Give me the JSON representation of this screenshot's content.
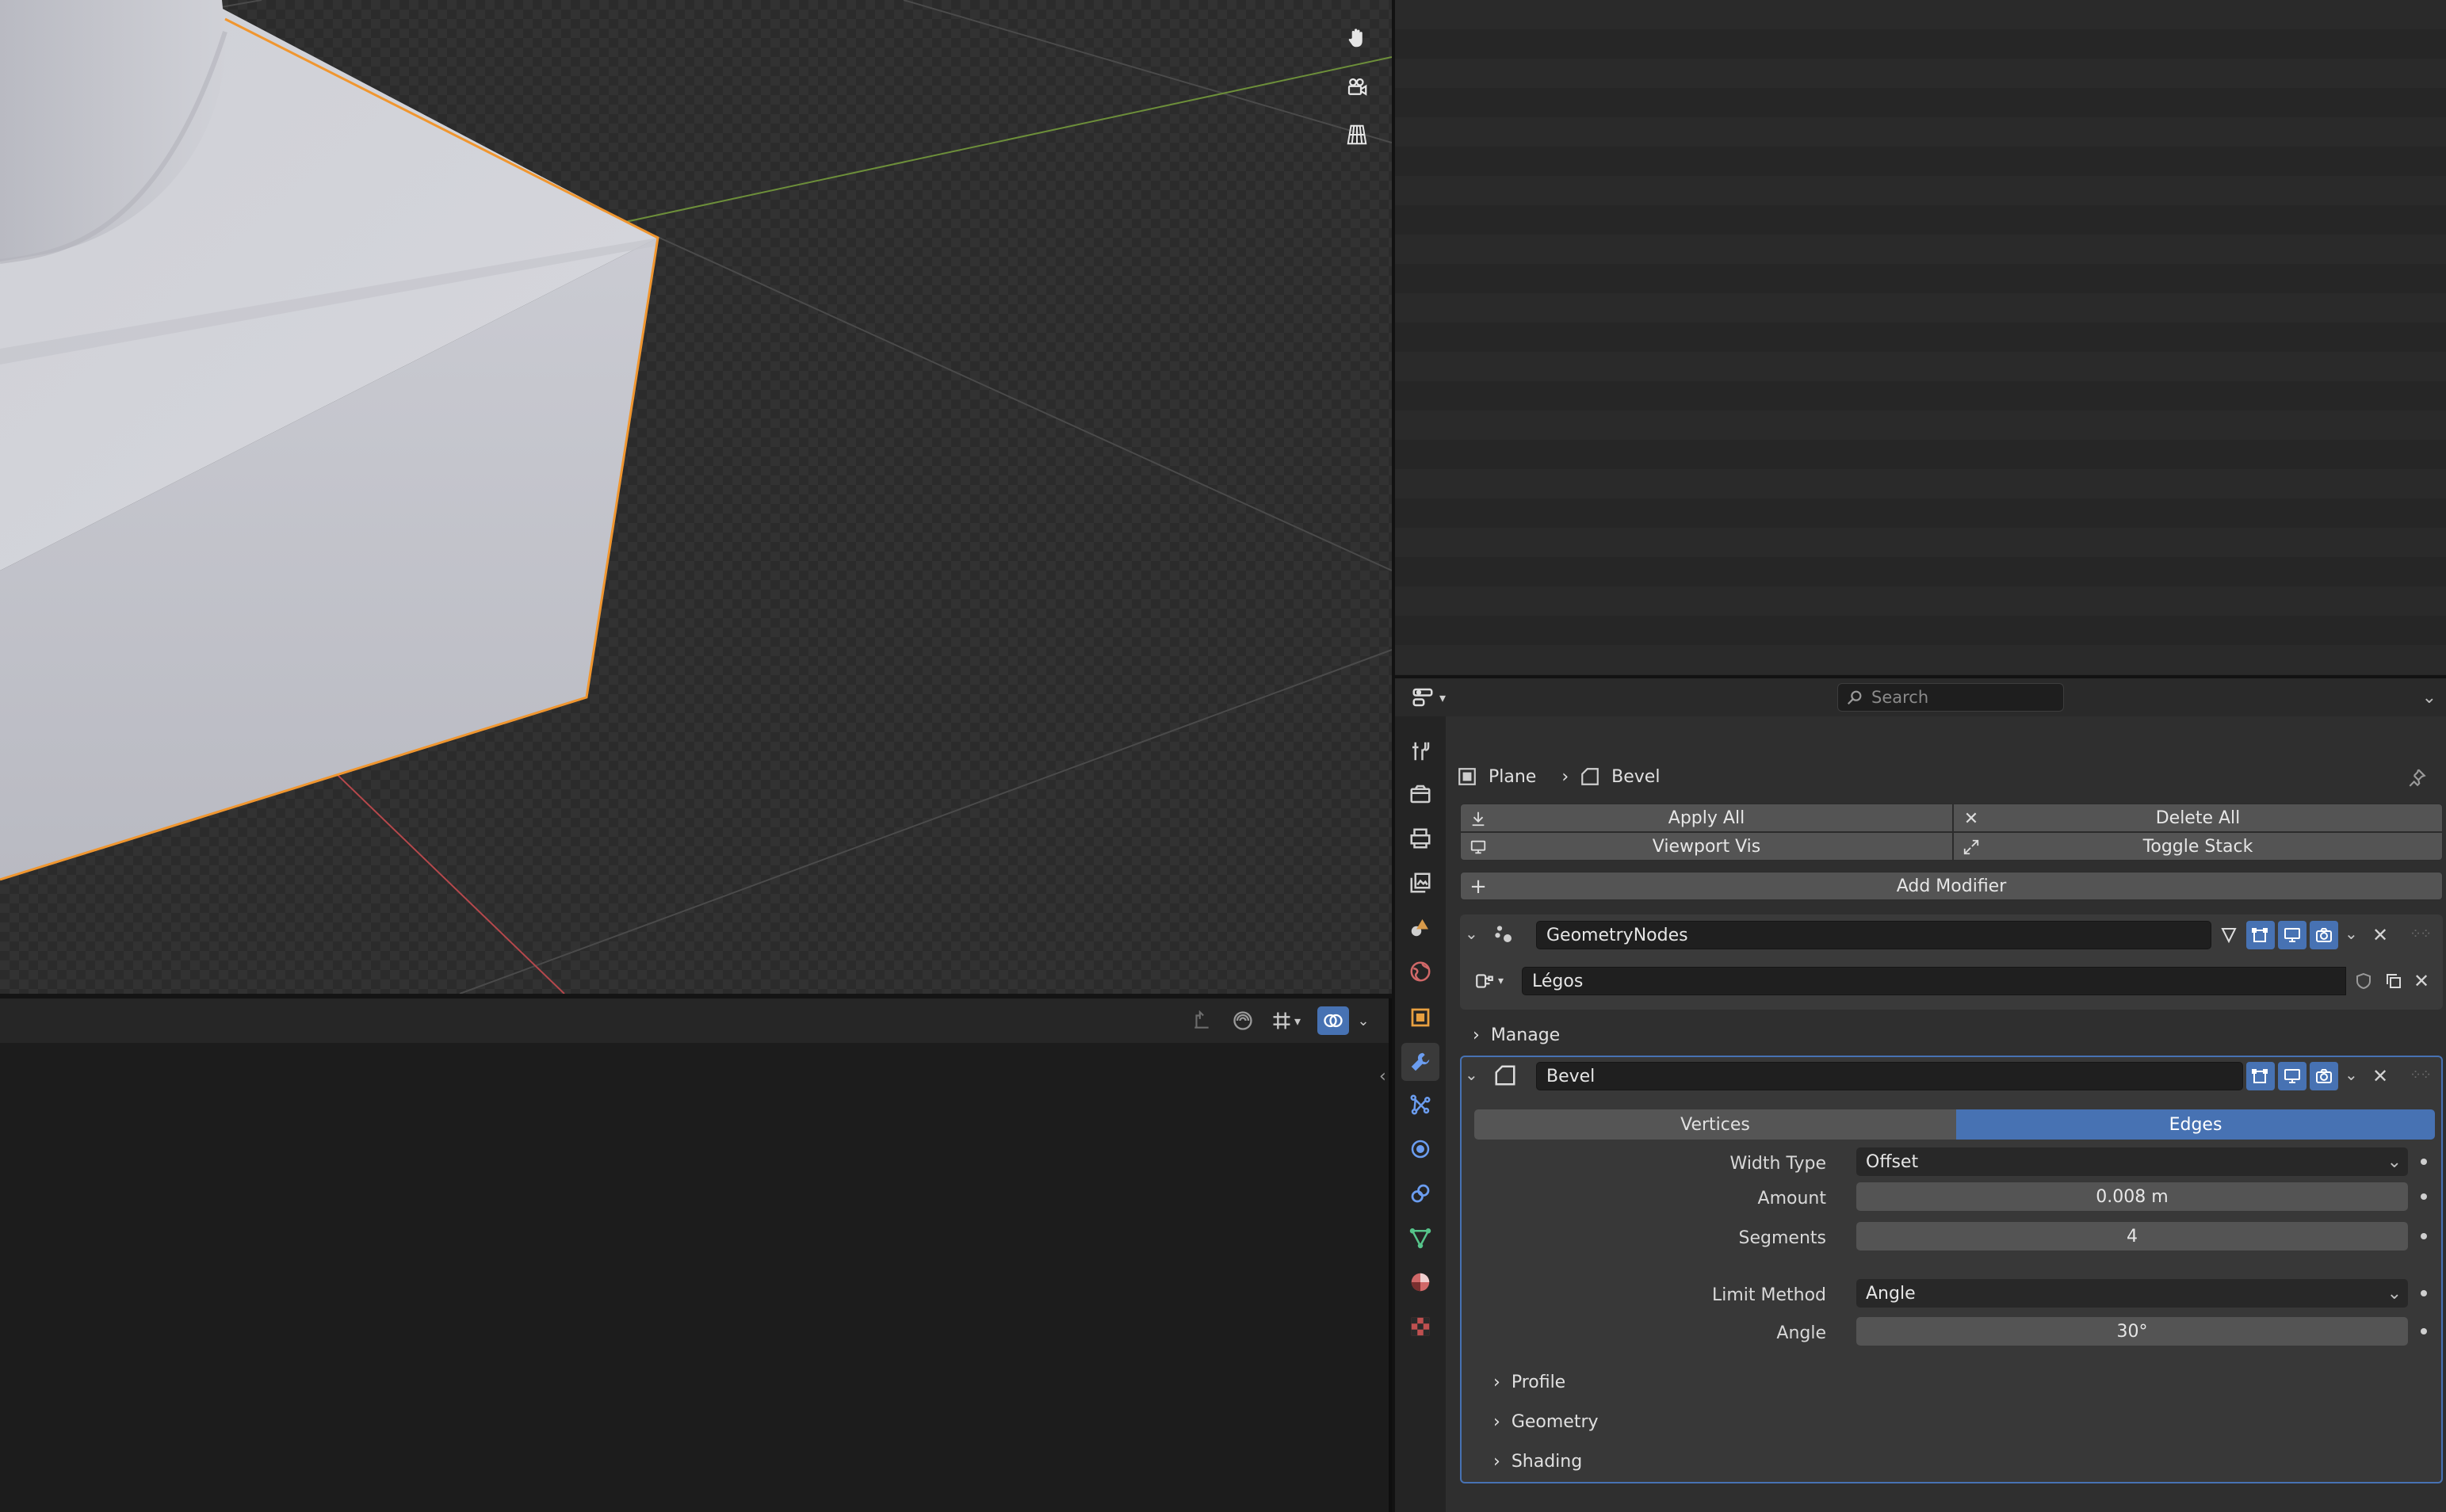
{
  "viewport": {
    "gizmo_icons": [
      "hand-pan-icon",
      "camera-view-icon",
      "perspective-grid-icon"
    ],
    "header_tools": [
      "snap-icon",
      "proportional-icon",
      "transform-orientation-icon",
      "overlay-icon"
    ]
  },
  "properties": {
    "search_placeholder": "Search",
    "breadcrumb": {
      "object": "Plane",
      "modifier": "Bevel"
    },
    "tabs": [
      {
        "name": "tool-icon",
        "active": false
      },
      {
        "name": "render-icon",
        "active": false
      },
      {
        "name": "output-icon",
        "active": false
      },
      {
        "name": "view-layer-icon",
        "active": false
      },
      {
        "name": "scene-icon",
        "active": false
      },
      {
        "name": "world-icon",
        "active": false
      },
      {
        "name": "object-icon",
        "active": false
      },
      {
        "name": "modifier-wrench-icon",
        "active": true
      },
      {
        "name": "particles-icon",
        "active": false
      },
      {
        "name": "physics-icon",
        "active": false
      },
      {
        "name": "constraints-icon",
        "active": false
      },
      {
        "name": "data-icon",
        "active": false
      },
      {
        "name": "material-icon",
        "active": false
      },
      {
        "name": "texture-icon",
        "active": false
      }
    ],
    "ops": {
      "apply_all": "Apply All",
      "delete_all": "Delete All",
      "viewport_vis": "Viewport Vis",
      "toggle_stack": "Toggle Stack",
      "add_modifier": "Add Modifier"
    },
    "geometry_nodes": {
      "name": "GeometryNodes",
      "node_group": "Légos",
      "manage": "Manage"
    },
    "bevel": {
      "name": "Bevel",
      "affect": [
        "Vertices",
        "Edges"
      ],
      "affect_selected": "Edges",
      "width_type_label": "Width Type",
      "width_type": "Offset",
      "amount_label": "Amount",
      "amount": "0.008 m",
      "segments_label": "Segments",
      "segments": "4",
      "limit_method_label": "Limit Method",
      "limit_method": "Angle",
      "angle_label": "Angle",
      "angle": "30°",
      "subpanels": [
        "Profile",
        "Geometry",
        "Shading"
      ]
    },
    "colors": {
      "accent": "#4772b3",
      "selection_outline": "#f0962f",
      "x_axis": "#b5484c",
      "y_axis": "#6d8f3a"
    }
  }
}
